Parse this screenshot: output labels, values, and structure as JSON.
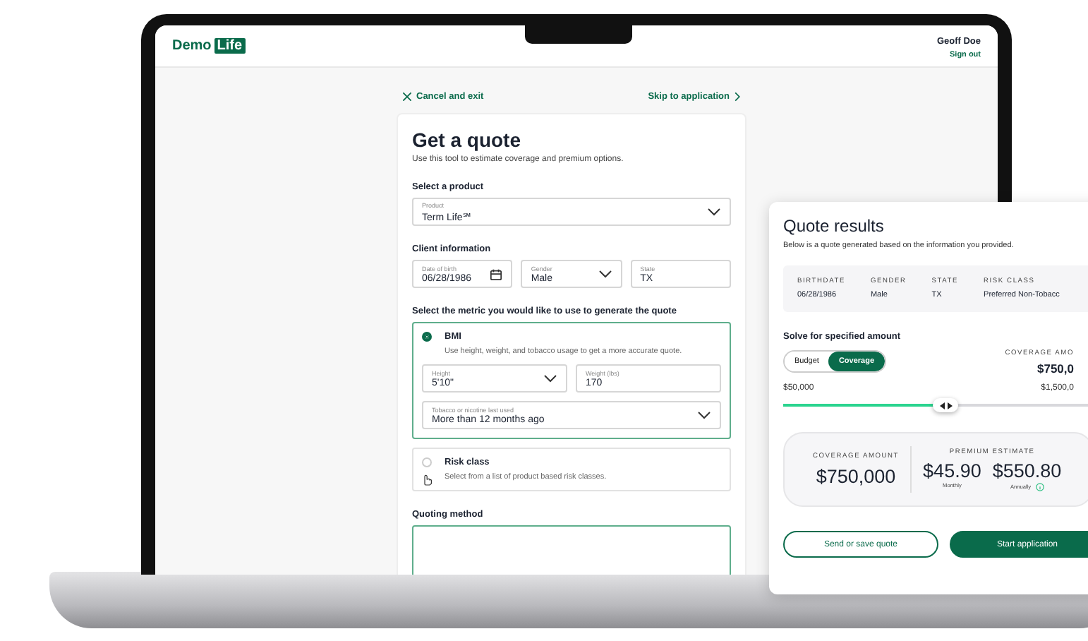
{
  "header": {
    "logo": {
      "text": "Demo",
      "highlight": "Life"
    },
    "user_name": "Geoff Doe",
    "sign_out": "Sign out"
  },
  "nav": {
    "cancel": "Cancel and exit",
    "skip": "Skip to application"
  },
  "form": {
    "title": "Get a quote",
    "subtitle": "Use this tool to estimate coverage and premium options.",
    "product_heading": "Select a product",
    "product": {
      "label": "Product",
      "value": "Term Life℠",
      "kind": "select"
    },
    "client_heading": "Client information",
    "client_fields": [
      {
        "label": "Date of birth",
        "value": "06/28/1986",
        "kind": "date"
      },
      {
        "label": "Gender",
        "value": "Male",
        "kind": "select"
      },
      {
        "label": "State",
        "value": "TX",
        "kind": "text"
      }
    ],
    "metric_heading": "Select the metric you would like to use to generate the quote",
    "metrics": [
      {
        "title": "BMI",
        "description": "Use height, weight, and tobacco usage to get a more accurate quote.",
        "selected": true,
        "fields": [
          {
            "label": "Height",
            "value": "5'10\"",
            "kind": "select"
          },
          {
            "label": "Weight (lbs)",
            "value": "170",
            "kind": "text"
          },
          {
            "label": "Tobacco or nicotine last used",
            "value": "More than 12 months ago",
            "kind": "select"
          }
        ]
      },
      {
        "title": "Risk class",
        "description": "Select from a list of product based risk classes.",
        "selected": false
      }
    ],
    "quoting_heading": "Quoting method"
  },
  "results": {
    "title": "Quote results",
    "subtitle": "Below is a quote generated based on the information you provided.",
    "summary": [
      {
        "label": "BIRTHDATE",
        "value": "06/28/1986"
      },
      {
        "label": "GENDER",
        "value": "Male"
      },
      {
        "label": "STATE",
        "value": "TX"
      },
      {
        "label": "RISK CLASS",
        "value": "Preferred Non-Tobacc"
      }
    ],
    "solve_heading": "Solve for specified amount",
    "toggle": [
      {
        "label": "Budget",
        "selected": false
      },
      {
        "label": "Coverage",
        "selected": true
      }
    ],
    "coverage_label": "COVERAGE AMO",
    "coverage_value": "$750,0",
    "slider": {
      "min_label": "$50,000",
      "max_label": "$1,500,0",
      "level": 0.48
    },
    "totals": {
      "coverage_label": "COVERAGE AMOUNT",
      "coverage_value": "$750,000",
      "premium_label": "PREMIUM ESTIMATE",
      "premiums": [
        {
          "value": "$45.90",
          "caption": "Monthly",
          "info": false
        },
        {
          "value": "$550.80",
          "caption": "Annually",
          "info": true
        }
      ]
    },
    "buttons": [
      {
        "label": "Send or save quote",
        "kind": "secondary"
      },
      {
        "label": "Start application",
        "kind": "primary"
      }
    ]
  }
}
